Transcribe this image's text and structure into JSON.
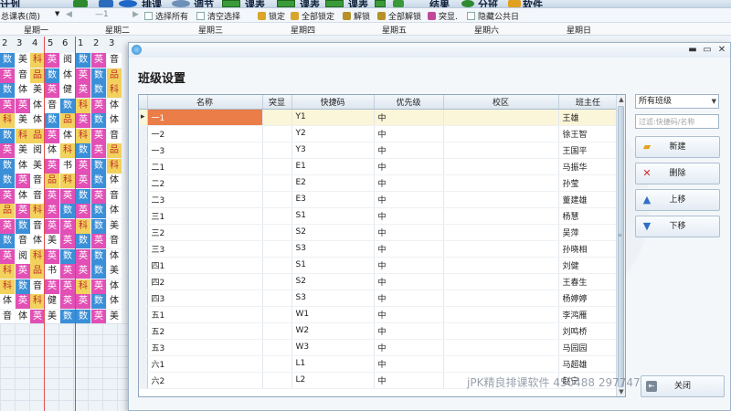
{
  "toolbar": {
    "items": [
      {
        "label": "计划",
        "icon": "app-logo-icon"
      },
      {
        "label": "排课",
        "icon": "schedule-icon"
      },
      {
        "label": "调节",
        "icon": "adjust-icon"
      },
      {
        "label": "课表",
        "icon": "timetable-icon"
      },
      {
        "label": "课表",
        "icon": "timetable-icon"
      },
      {
        "label": "课表",
        "icon": "timetable-icon"
      },
      {
        "label": "结果",
        "icon": "result-icon"
      },
      {
        "label": "分班",
        "icon": "split-class-icon"
      },
      {
        "label": "软件",
        "icon": "software-icon"
      }
    ]
  },
  "subbar": {
    "table_selector": "总课表(简)",
    "week_indicator": "—1",
    "select_all": "选择所有",
    "clear_selection": "清空选择",
    "lock": "锁定",
    "lock_all": "全部锁定",
    "unlock": "解锁",
    "unlock_all": "全部解锁",
    "highlight": "突显.",
    "hide_public": "隐藏公共日"
  },
  "days": [
    "星期一",
    "星期二",
    "星期三",
    "星期四",
    "星期五",
    "星期六",
    "星期日"
  ],
  "periods": [
    "2",
    "3",
    "4",
    "5",
    "6",
    "1",
    "2",
    "3"
  ],
  "schedule": [
    [
      "数",
      "美",
      "科",
      "英",
      "阅",
      "数",
      "英",
      "音"
    ],
    [
      "英",
      "音",
      "品",
      "数",
      "体",
      "英",
      "数",
      "品"
    ],
    [
      "数",
      "体",
      "美",
      "英",
      "健",
      "英",
      "数",
      "科"
    ],
    [
      "英",
      "英",
      "体",
      "音",
      "数",
      "科",
      "英",
      "体"
    ],
    [
      "科",
      "美",
      "体",
      "数",
      "品",
      "英",
      "数",
      "体"
    ],
    [
      "数",
      "科",
      "品",
      "英",
      "体",
      "科",
      "英",
      "音"
    ],
    [
      "英",
      "美",
      "阅",
      "体",
      "科",
      "数",
      "英",
      "品"
    ],
    [
      "数",
      "体",
      "美",
      "英",
      "书",
      "英",
      "数",
      "科"
    ],
    [
      "数",
      "英",
      "音",
      "品",
      "科",
      "英",
      "数",
      "体"
    ],
    [
      "英",
      "体",
      "音",
      "英",
      "英",
      "数",
      "英",
      "音"
    ],
    [
      "品",
      "英",
      "科",
      "英",
      "数",
      "英",
      "数",
      "体"
    ],
    [
      "英",
      "数",
      "音",
      "英",
      "英",
      "科",
      "数",
      "美"
    ],
    [
      "数",
      "音",
      "体",
      "美",
      "英",
      "数",
      "英",
      "音"
    ],
    [
      "英",
      "阅",
      "科",
      "英",
      "数",
      "英",
      "数",
      "体"
    ],
    [
      "科",
      "英",
      "品",
      "书",
      "英",
      "英",
      "数",
      "美"
    ],
    [
      "科",
      "数",
      "音",
      "英",
      "英",
      "科",
      "英",
      "体"
    ],
    [
      "体",
      "英",
      "科",
      "健",
      "英",
      "英",
      "数",
      "体"
    ],
    [
      "音",
      "体",
      "英",
      "美",
      "数",
      "数",
      "英",
      "美"
    ]
  ],
  "dialog": {
    "title": "班级设置",
    "window_controls": {
      "minimize": "▬",
      "maximize": "▭",
      "close": "✕"
    },
    "columns": [
      "名称",
      "突显",
      "快捷码",
      "优先级",
      "校区",
      "班主任"
    ],
    "rows": [
      {
        "name": "一1",
        "highlight": "",
        "code": "Y1",
        "priority": "中",
        "campus": "",
        "teacher": "王雄"
      },
      {
        "name": "一2",
        "highlight": "",
        "code": "Y2",
        "priority": "中",
        "campus": "",
        "teacher": "徐王智"
      },
      {
        "name": "一3",
        "highlight": "",
        "code": "Y3",
        "priority": "中",
        "campus": "",
        "teacher": "王国平"
      },
      {
        "name": "二1",
        "highlight": "",
        "code": "E1",
        "priority": "中",
        "campus": "",
        "teacher": "马振华"
      },
      {
        "name": "二2",
        "highlight": "",
        "code": "E2",
        "priority": "中",
        "campus": "",
        "teacher": "孙莹"
      },
      {
        "name": "二3",
        "highlight": "",
        "code": "E3",
        "priority": "中",
        "campus": "",
        "teacher": "董建雄"
      },
      {
        "name": "三1",
        "highlight": "",
        "code": "S1",
        "priority": "中",
        "campus": "",
        "teacher": "杨慧"
      },
      {
        "name": "三2",
        "highlight": "",
        "code": "S2",
        "priority": "中",
        "campus": "",
        "teacher": "吴萍"
      },
      {
        "name": "三3",
        "highlight": "",
        "code": "S3",
        "priority": "中",
        "campus": "",
        "teacher": "孙晓相"
      },
      {
        "name": "四1",
        "highlight": "",
        "code": "S1",
        "priority": "中",
        "campus": "",
        "teacher": "刘健"
      },
      {
        "name": "四2",
        "highlight": "",
        "code": "S2",
        "priority": "中",
        "campus": "",
        "teacher": "王春生"
      },
      {
        "name": "四3",
        "highlight": "",
        "code": "S3",
        "priority": "中",
        "campus": "",
        "teacher": "杨婷婷"
      },
      {
        "name": "五1",
        "highlight": "",
        "code": "W1",
        "priority": "中",
        "campus": "",
        "teacher": "李鸿雁"
      },
      {
        "name": "五2",
        "highlight": "",
        "code": "W2",
        "priority": "中",
        "campus": "",
        "teacher": "刘鸣桥"
      },
      {
        "name": "五3",
        "highlight": "",
        "code": "W3",
        "priority": "中",
        "campus": "",
        "teacher": "马园园"
      },
      {
        "name": "六1",
        "highlight": "",
        "code": "L1",
        "priority": "中",
        "campus": "",
        "teacher": "马超雄"
      },
      {
        "name": "六2",
        "highlight": "",
        "code": "L2",
        "priority": "中",
        "campus": "",
        "teacher": "赵宁"
      }
    ],
    "class_filter": "所有班级",
    "filter_placeholder": "过滤:快捷码/名称",
    "buttons": {
      "add": "新建",
      "delete": "删除",
      "move_up": "上移",
      "move_down": "下移",
      "close": "关闭"
    }
  },
  "watermark_text": "jPK精良排课软件 450488 2977476",
  "colors": {
    "selected_cell": "#ea7d48",
    "selected_row": "#fbf6d9",
    "subject_english": "#e24fb5",
    "subject_math": "#3a8fd8"
  }
}
